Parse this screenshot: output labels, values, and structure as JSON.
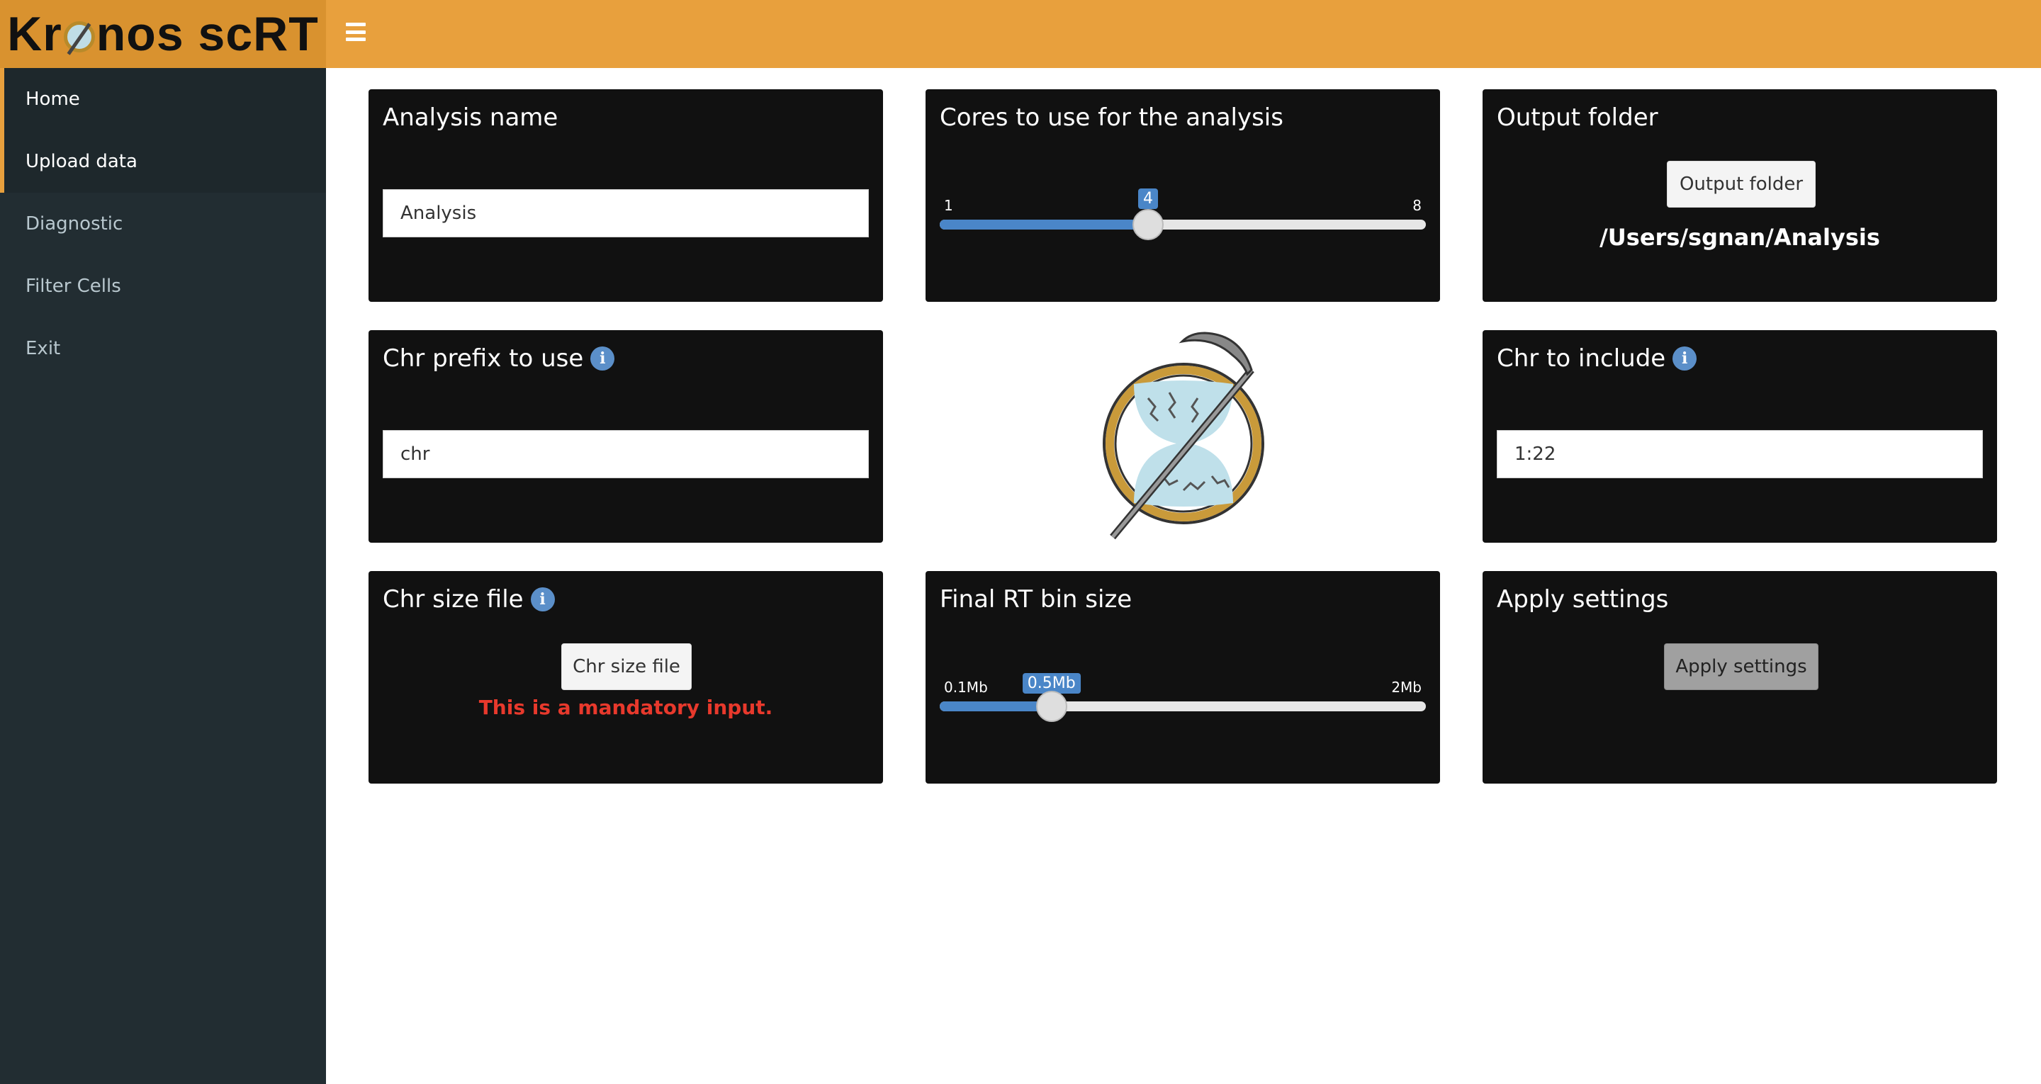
{
  "app": {
    "title_prefix": "Kr",
    "title_suffix": "nos scRT"
  },
  "sidebar": {
    "items": [
      {
        "label": "Home",
        "active": true
      },
      {
        "label": "Upload data",
        "active": true
      },
      {
        "label": "Diagnostic",
        "active": false
      },
      {
        "label": "Filter Cells",
        "active": false
      },
      {
        "label": "Exit",
        "active": false
      }
    ]
  },
  "panels": {
    "analysis_name": {
      "title": "Analysis name",
      "value": "Analysis"
    },
    "cores": {
      "title": "Cores to use for the analysis",
      "min": "1",
      "max": "8",
      "value": "4",
      "min_num": 1,
      "max_num": 8,
      "value_num": 4
    },
    "output_folder": {
      "title": "Output folder",
      "button": "Output folder",
      "path": "/Users/sgnan/Analysis"
    },
    "chr_prefix": {
      "title": "Chr prefix to use",
      "value": "chr"
    },
    "chr_include": {
      "title": "Chr to include",
      "value": "1:22"
    },
    "chr_size": {
      "title": "Chr size file",
      "button": "Chr size file",
      "warning": "This is a mandatory input."
    },
    "bin_size": {
      "title": "Final RT bin size",
      "min": "0.1Mb",
      "max": "2Mb",
      "value": "0.5Mb",
      "fraction": 0.23
    },
    "apply": {
      "title": "Apply settings",
      "button": "Apply settings"
    }
  },
  "colors": {
    "header": "#e8a03d",
    "sidebar": "#222d32",
    "accent": "#4a86c8",
    "warning": "#e8392c"
  },
  "icons": {
    "menu": "hamburger-icon",
    "info": "info-icon"
  }
}
